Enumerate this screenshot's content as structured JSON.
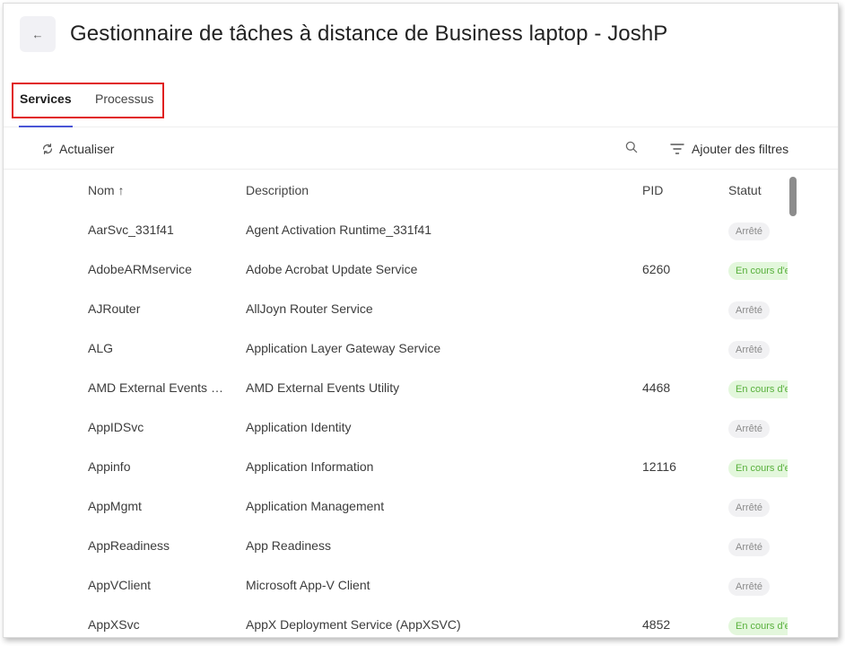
{
  "header": {
    "back_icon": "←",
    "title": "Gestionnaire de tâches à distance de Business laptop - JoshP"
  },
  "tabs": [
    {
      "label": "Services",
      "active": true
    },
    {
      "label": "Processus",
      "active": false
    }
  ],
  "toolbar": {
    "refresh_label": "Actualiser",
    "filter_label": "Ajouter des filtres"
  },
  "table": {
    "columns": {
      "name": "Nom ↑",
      "description": "Description",
      "pid": "PID",
      "status": "Statut"
    },
    "rows": [
      {
        "name": "AarSvc_331f41",
        "description": "Agent Activation Runtime_331f41",
        "pid": "",
        "status": "Arrêté",
        "state": "stopped"
      },
      {
        "name": "AdobeARMservice",
        "description": "Adobe Acrobat Update Service",
        "pid": "6260",
        "status": "En cours d'exécution",
        "state": "running"
      },
      {
        "name": "AJRouter",
        "description": "AllJoyn Router Service",
        "pid": "",
        "status": "Arrêté",
        "state": "stopped"
      },
      {
        "name": "ALG",
        "description": "Application Layer Gateway Service",
        "pid": "",
        "status": "Arrêté",
        "state": "stopped"
      },
      {
        "name": "AMD External Events Utility",
        "description": "AMD External Events Utility",
        "pid": "4468",
        "status": "En cours d'exécution",
        "state": "running"
      },
      {
        "name": "AppIDSvc",
        "description": "Application Identity",
        "pid": "",
        "status": "Arrêté",
        "state": "stopped"
      },
      {
        "name": "Appinfo",
        "description": "Application Information",
        "pid": "12116",
        "status": "En cours d'exécution",
        "state": "running"
      },
      {
        "name": "AppMgmt",
        "description": "Application Management",
        "pid": "",
        "status": "Arrêté",
        "state": "stopped"
      },
      {
        "name": "AppReadiness",
        "description": "App Readiness",
        "pid": "",
        "status": "Arrêté",
        "state": "stopped"
      },
      {
        "name": "AppVClient",
        "description": "Microsoft App-V Client",
        "pid": "",
        "status": "Arrêté",
        "state": "stopped"
      },
      {
        "name": "AppXSvc",
        "description": "AppX Deployment Service (AppXSVC)",
        "pid": "4852",
        "status": "En cours d'exécution",
        "state": "running"
      }
    ]
  },
  "colors": {
    "accent": "#4a55d6",
    "highlight": "#e01e1e",
    "running_bg": "#e3f7dc",
    "running_text": "#58b03c",
    "stopped_bg": "#f1f1f3",
    "stopped_text": "#8a8a8a"
  }
}
